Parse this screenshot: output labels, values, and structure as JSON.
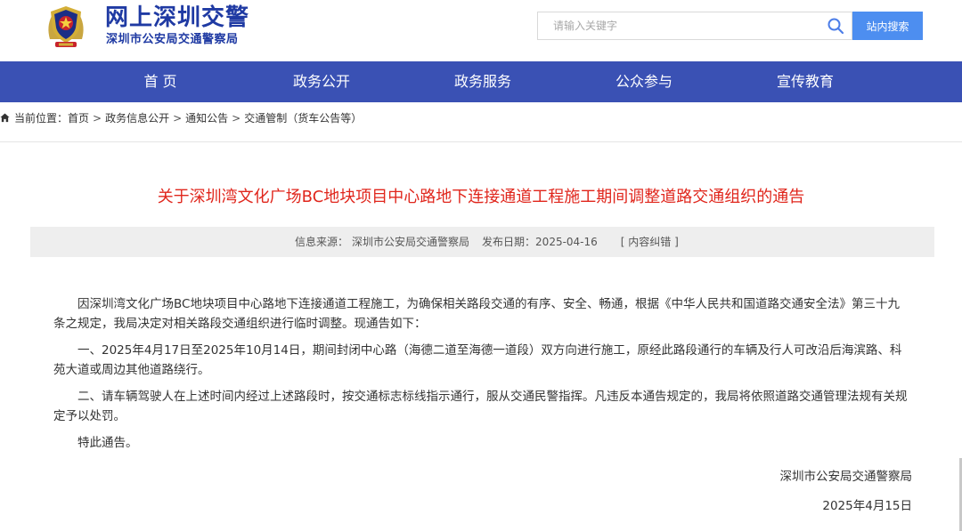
{
  "header": {
    "site_title": "网上深圳交警",
    "site_subtitle": "深圳市公安局交通警察局",
    "emblem_icon": "police-emblem-icon",
    "search": {
      "placeholder": "请输入关键字",
      "value": "",
      "button_label": "站内搜索"
    }
  },
  "colors": {
    "brand_blue": "#1f3aa3",
    "nav_background": "#3a51b4",
    "search_button": "#4d8ef0",
    "title_red": "#e0261c"
  },
  "nav": {
    "items": [
      {
        "label": "首 页"
      },
      {
        "label": "政务公开"
      },
      {
        "label": "政务服务"
      },
      {
        "label": "公众参与"
      },
      {
        "label": "宣传教育"
      }
    ]
  },
  "breadcrumb": {
    "prefix": "当前位置：",
    "items": [
      "首页",
      "政务信息公开",
      "通知公告",
      "交通管制（货车公告等）"
    ],
    "separator": ">"
  },
  "article": {
    "title": "关于深圳湾文化广场BC地块项目中心路地下连接通道工程施工期间调整道路交通组织的通告",
    "meta": {
      "source_label": "信息来源：",
      "source_value": "深圳市公安局交通警察局",
      "date_label": "发布日期：",
      "date_value": "2025-04-16",
      "feedback_label": "[ 内容纠错 ]"
    },
    "paragraphs": [
      "因深圳湾文化广场BC地块项目中心路地下连接通道工程施工，为确保相关路段交通的有序、安全、畅通，根据《中华人民共和国道路交通安全法》第三十九条之规定，我局决定对相关路段交通组织进行临时调整。现通告如下：",
      "一、2025年4月17日至2025年10月14日，期间封闭中心路（海德二道至海德一道段）双方向进行施工，原经此路段通行的车辆及行人可改沿后海滨路、科苑大道或周边其他道路绕行。",
      "二、请车辆驾驶人在上述时间内经过上述路段时，按交通标志标线指示通行，服从交通民警指挥。凡违反本通告规定的，我局将依照道路交通管理法规有关规定予以处罚。",
      "特此通告。"
    ],
    "signature": {
      "org": "深圳市公安局交通警察局",
      "date": "2025年4月15日"
    }
  }
}
